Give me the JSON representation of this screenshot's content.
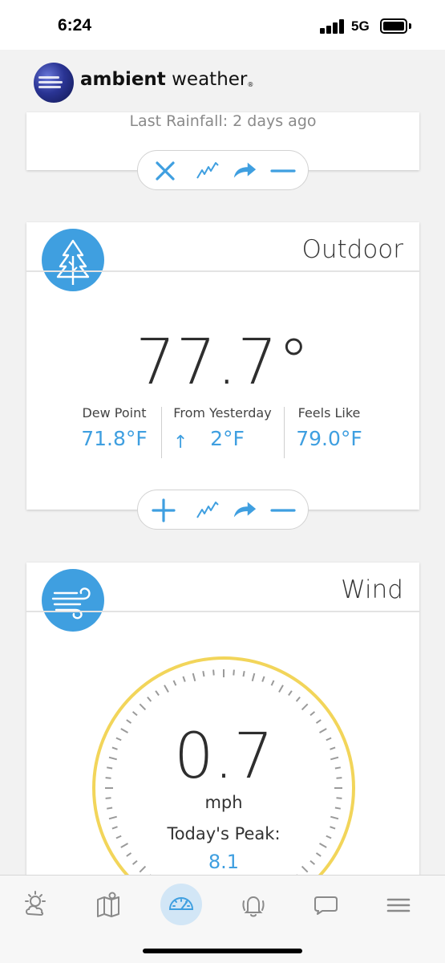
{
  "status_bar": {
    "time": "6:24",
    "network": "5G"
  },
  "brand": {
    "bold": "ambient",
    "regular": " weather",
    "mark": "®"
  },
  "rain_card": {
    "last_rainfall": "Last Rainfall: 2 days ago",
    "controls": [
      "close-icon",
      "chart-icon",
      "share-icon",
      "collapse-icon"
    ]
  },
  "outdoor_card": {
    "title": "Outdoor",
    "icon": "tree-icon",
    "temperature": "77.7°",
    "stats": [
      {
        "label": "Dew Point",
        "value": "71.8°F"
      },
      {
        "label": "From Yesterday",
        "value": "2°F",
        "trend": "↑"
      },
      {
        "label": "Feels Like",
        "value": "79.0°F"
      }
    ],
    "controls": [
      "add-icon",
      "chart-icon",
      "share-icon",
      "collapse-icon"
    ]
  },
  "wind_card": {
    "title": "Wind",
    "icon": "wind-icon",
    "speed": "0.7",
    "unit": "mph",
    "peak_label": "Today's Peak:",
    "peak_value": "8.1"
  },
  "bottom_nav": {
    "items": [
      "forecast-icon",
      "map-icon",
      "dashboard-icon",
      "alerts-icon",
      "messages-icon",
      "menu-icon"
    ],
    "active": "dashboard-icon"
  },
  "colors": {
    "accent": "#3f9fe0",
    "gauge_ring": "#f2d55a",
    "background": "#f2f2f2"
  }
}
